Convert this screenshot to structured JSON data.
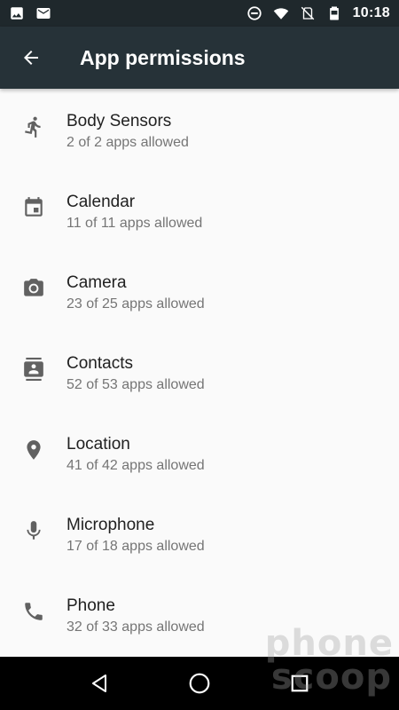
{
  "status_bar": {
    "time": "10:18",
    "icons_left": [
      "image-notification-icon",
      "gmail-notification-icon"
    ],
    "icons_right": [
      "do-not-disturb-icon",
      "wifi-icon",
      "no-sim-icon",
      "battery-icon"
    ]
  },
  "app_bar": {
    "title": "App permissions",
    "back_icon": "arrow-back-icon",
    "background": "#263238"
  },
  "permissions": [
    {
      "icon": "body-sensors-icon",
      "title": "Body Sensors",
      "subtitle": "2 of 2 apps allowed"
    },
    {
      "icon": "calendar-icon",
      "title": "Calendar",
      "subtitle": "11 of 11 apps allowed"
    },
    {
      "icon": "camera-icon",
      "title": "Camera",
      "subtitle": "23 of 25 apps allowed"
    },
    {
      "icon": "contacts-icon",
      "title": "Contacts",
      "subtitle": "52 of 53 apps allowed"
    },
    {
      "icon": "location-icon",
      "title": "Location",
      "subtitle": "41 of 42 apps allowed"
    },
    {
      "icon": "microphone-icon",
      "title": "Microphone",
      "subtitle": "17 of 18 apps allowed"
    },
    {
      "icon": "phone-icon",
      "title": "Phone",
      "subtitle": "32 of 33 apps allowed"
    }
  ],
  "nav_bar": {
    "buttons": [
      "back-triangle-icon",
      "home-circle-icon",
      "recents-square-icon"
    ]
  },
  "watermark": {
    "line1": "phone",
    "line2": "scoop"
  }
}
